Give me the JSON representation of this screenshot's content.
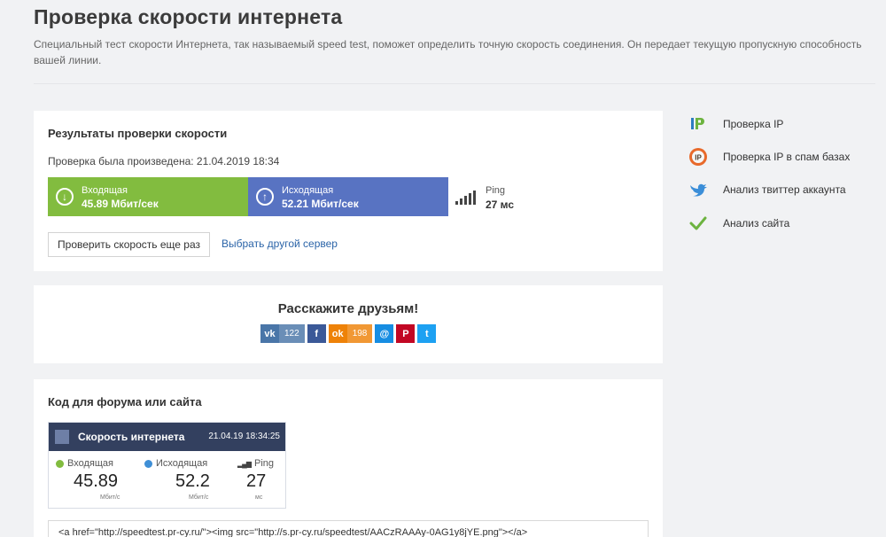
{
  "page": {
    "title": "Проверка скорости интернета",
    "description": "Специальный тест скорости Интернета, так называемый speed test, поможет определить точную скорость соединения. Он передает текущую пропускную способность вашей линии."
  },
  "results": {
    "title": "Результаты проверки скорости",
    "date_text": "Проверка была произведена: 21.04.2019 18:34",
    "download": {
      "label": "Входящая",
      "value": "45.89 Мбит/сек",
      "color": "#82bc3f"
    },
    "upload": {
      "label": "Исходящая",
      "value": "52.21 Мбит/сек",
      "color": "#5873c2"
    },
    "ping": {
      "label": "Ping",
      "value": "27 мс"
    },
    "retest_label": "Проверить скорость еще раз",
    "server_link": "Выбрать другой сервер"
  },
  "share": {
    "title": "Расскажите друзьям!",
    "buttons": [
      {
        "icon": "vk-icon",
        "glyph": "vk",
        "count": "122",
        "color": "#4a76a8"
      },
      {
        "icon": "facebook-icon",
        "glyph": "f",
        "count": "",
        "color": "#3b5998"
      },
      {
        "icon": "odnoklassniki-icon",
        "glyph": "ok",
        "count": "198",
        "color": "#ee8208"
      },
      {
        "icon": "moimir-icon",
        "glyph": "@",
        "count": "",
        "color": "#168de2"
      },
      {
        "icon": "pinterest-icon",
        "glyph": "P",
        "count": "",
        "color": "#c20724"
      },
      {
        "icon": "twitter-icon",
        "glyph": "t",
        "count": "",
        "color": "#1da1f2"
      }
    ]
  },
  "code": {
    "title": "Код для форума или сайта",
    "widget": {
      "title": "Скорость интернета",
      "date": "21.04.19 18:34:25",
      "download_label": "Входящая",
      "download_value": "45.89",
      "download_unit": "Мбит/с",
      "upload_label": "Исходящая",
      "upload_value": "52.2",
      "upload_unit": "Мбит/с",
      "ping_label": "Ping",
      "ping_value": "27",
      "ping_unit": "мс"
    },
    "snippet": "<a href=\"http://speedtest.pr-cy.ru/\"><img src=\"http://s.pr-cy.ru/speedtest/AACzRAAAy-0AG1y8jYE.png\"></a>"
  },
  "sidebar": {
    "items": [
      {
        "label": "Проверка IP",
        "icon": "ip-icon"
      },
      {
        "label": "Проверка IP в спам базах",
        "icon": "ip-spam-icon"
      },
      {
        "label": "Анализ твиттер аккаунта",
        "icon": "twitter-bird-icon"
      },
      {
        "label": "Анализ сайта",
        "icon": "checkmark-icon"
      }
    ]
  }
}
